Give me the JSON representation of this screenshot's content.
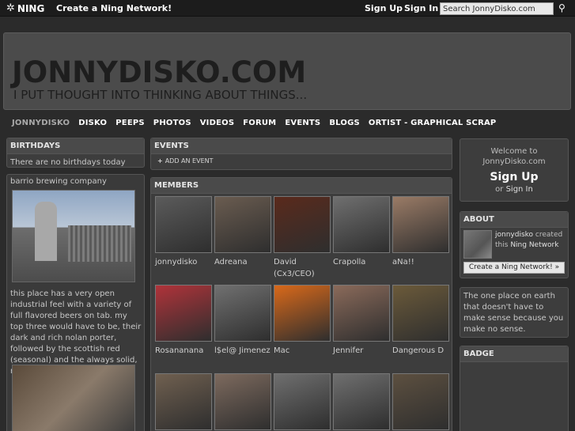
{
  "topbar": {
    "logo": "NING",
    "create_network": "Create a Ning Network!",
    "sign_up": "Sign Up",
    "sign_in": "Sign In",
    "search_value": "Search JonnyDisko.com"
  },
  "header": {
    "title": "JONNYDISKO.COM",
    "tagline": "I PUT THOUGHT INTO THINKING ABOUT THINGS..."
  },
  "nav": [
    "JONNYDISKO",
    "DISKO",
    "PEEPS",
    "PHOTOS",
    "VIDEOS",
    "FORUM",
    "EVENTS",
    "BLOGS",
    "ORTIST - GRAPHICAL SCRAP"
  ],
  "birthdays": {
    "title": "BIRTHDAYS",
    "text": "There are no birthdays today"
  },
  "blog": {
    "heading": "barrio brewing company",
    "body": "this place has a very open industrial feel with a variety of full flavored beers on tab. my top three would have to be, their dark and rich nolan porter, followed by the scottish red (seasonal) and the always solid, red amber cat."
  },
  "events": {
    "title": "EVENTS",
    "add": "ADD AN EVENT"
  },
  "members": {
    "title": "MEMBERS",
    "list": [
      {
        "name": "jonnydisko",
        "color": "#5b5b5b"
      },
      {
        "name": "Adreana",
        "color": "#6a5c50"
      },
      {
        "name": "David (Cx3/CEO)",
        "color": "#5a2a1c"
      },
      {
        "name": "Crapolla",
        "color": "#6f6f6f"
      },
      {
        "name": "aNa!!",
        "color": "#9a7b66"
      },
      {
        "name": "Rosananana",
        "color": "#b0333a"
      },
      {
        "name": "l$el@ Jimenez",
        "color": "#707070"
      },
      {
        "name": "Mac",
        "color": "#d9691a"
      },
      {
        "name": "Jennifer",
        "color": "#8a6a5a"
      },
      {
        "name": "Dangerous D",
        "color": "#6b5a3a"
      },
      {
        "name": "",
        "color": "#706050"
      },
      {
        "name": "",
        "color": "#7d6a5e"
      },
      {
        "name": "",
        "color": "#6f6f6f"
      },
      {
        "name": "",
        "color": "#6f6f6f"
      },
      {
        "name": "",
        "color": "#5d5040"
      }
    ]
  },
  "welcome": {
    "line1": "Welcome to",
    "line2": "JonnyDisko.com",
    "sign_up": "Sign Up",
    "or": "or",
    "sign_in": "Sign In"
  },
  "about": {
    "title": "ABOUT",
    "user": "jonnydisko",
    "created": "created this",
    "network": "Ning Network",
    "button": "Create a Ning Network! »"
  },
  "description": "The one place on earth that doesn't have to make sense because you make no sense.",
  "badge": {
    "title": "BADGE"
  }
}
